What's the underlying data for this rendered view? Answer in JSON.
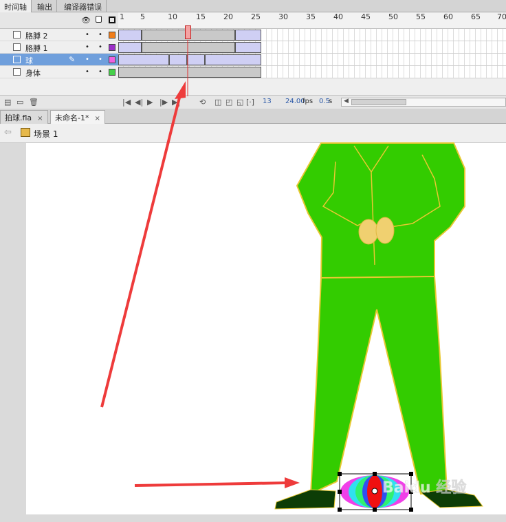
{
  "panel_tabs": [
    "时间轴",
    "输出",
    "编译器错误"
  ],
  "timeline": {
    "header_icons": [
      "eye-icon",
      "lock-icon",
      "outline-icon"
    ],
    "ruler_ticks": [
      "1",
      "5",
      "10",
      "15",
      "20",
      "25",
      "30",
      "35",
      "40",
      "45",
      "50",
      "55",
      "60",
      "65",
      "70"
    ],
    "layers": [
      {
        "name": "胳膊 2",
        "color": "#f07d1a",
        "selected": false
      },
      {
        "name": "胳膊 1",
        "color": "#9b2fc8",
        "selected": false
      },
      {
        "name": "球",
        "color": "#f060e0",
        "selected": true
      },
      {
        "name": "身体",
        "color": "#45d04a",
        "selected": false
      }
    ],
    "current_frame": "13",
    "fps": "24.00",
    "fps_unit": "fps",
    "elapsed": "0.5",
    "elapsed_unit": "s"
  },
  "document_tabs": [
    {
      "label": "拍球.fla",
      "close": "×",
      "active": false
    },
    {
      "label": "未命名-1*",
      "close": "×",
      "active": true
    }
  ],
  "edit_bar": {
    "scene": "场景 1"
  },
  "colors": {
    "suit": "#33cc00",
    "suit_outline": "#e8c832",
    "hands": "#f0d070",
    "shoes": "#0d3d06",
    "annotation_arrow": "#ee3b3b",
    "playhead": "#e03030"
  },
  "watermark": {
    "text": "Baidu 经验"
  }
}
